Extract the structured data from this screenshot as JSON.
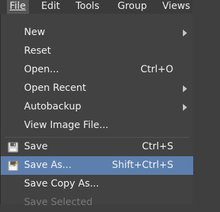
{
  "menubar": {
    "items": [
      {
        "label": "File",
        "mnemonic_index": 0
      },
      {
        "label": "Edit",
        "mnemonic_index": 0
      },
      {
        "label": "Tools",
        "mnemonic_index": 0
      },
      {
        "label": "Group",
        "mnemonic_index": 0
      },
      {
        "label": "Views",
        "mnemonic_index": 0
      }
    ]
  },
  "file_menu": {
    "items": [
      {
        "label": "New",
        "shortcut": "",
        "submenu": true
      },
      {
        "label": "Reset",
        "shortcut": "",
        "submenu": false
      },
      {
        "label": "Open...",
        "shortcut": "Ctrl+O",
        "submenu": false
      },
      {
        "label": "Open Recent",
        "shortcut": "",
        "submenu": true
      },
      {
        "label": "Autobackup",
        "shortcut": "",
        "submenu": true
      },
      {
        "label": "View Image File...",
        "shortcut": "",
        "submenu": false
      },
      {
        "label": "Save",
        "shortcut": "Ctrl+S",
        "submenu": false,
        "icon": "floppy-disk-icon"
      },
      {
        "label": "Save As...",
        "shortcut": "Shift+Ctrl+S",
        "submenu": false,
        "icon": "floppy-disk-edit-icon",
        "highlighted": true
      },
      {
        "label": "Save Copy As...",
        "shortcut": "",
        "submenu": false
      },
      {
        "label": "Save Selected",
        "shortcut": "",
        "submenu": false,
        "disabled": true
      }
    ]
  },
  "colors": {
    "menubar_bg": "#3b3b3b",
    "menu_bg": "#424242",
    "highlight": "#5d7fae",
    "text": "#f2f2f2",
    "disabled_text": "#7a7a7a"
  }
}
